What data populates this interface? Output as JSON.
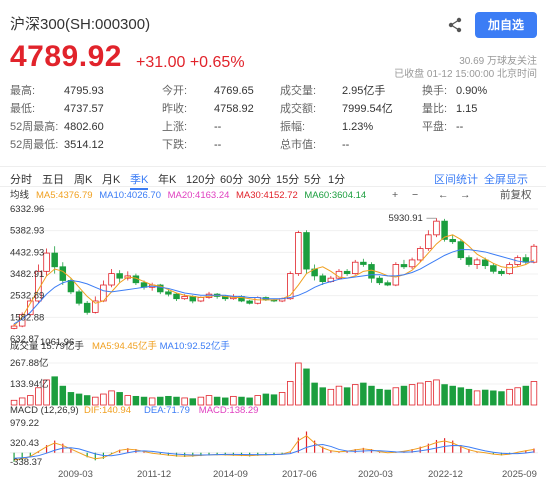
{
  "header": {
    "title": "沪深300(SH:000300)",
    "add_label": "加自选",
    "price": "4789.92",
    "change": "+31.00 +0.65%",
    "followers": "30.69 万球友关注",
    "status": "已收盘 01-12 15:00:00 北京时间"
  },
  "stats": [
    [
      {
        "l": "最高:",
        "v": "4795.93",
        "c": "red"
      },
      {
        "l": "今开:",
        "v": "4769.65",
        "c": "red"
      },
      {
        "l": "成交量:",
        "v": "2.95亿手",
        "c": ""
      },
      {
        "l": "换手:",
        "v": "0.90%",
        "c": ""
      }
    ],
    [
      {
        "l": "最低:",
        "v": "4737.57",
        "c": "green"
      },
      {
        "l": "昨收:",
        "v": "4758.92",
        "c": ""
      },
      {
        "l": "成交额:",
        "v": "7999.54亿",
        "c": ""
      },
      {
        "l": "量比:",
        "v": "1.15",
        "c": "red"
      }
    ],
    [
      {
        "l": "52周最高:",
        "v": "4802.60",
        "c": ""
      },
      {
        "l": "上涨:",
        "v": "--",
        "c": ""
      },
      {
        "l": "振幅:",
        "v": "1.23%",
        "c": ""
      },
      {
        "l": "平盘:",
        "v": "--",
        "c": ""
      }
    ],
    [
      {
        "l": "52周最低:",
        "v": "3514.12",
        "c": ""
      },
      {
        "l": "下跌:",
        "v": "--",
        "c": ""
      },
      {
        "l": "总市值:",
        "v": "--",
        "c": ""
      },
      {
        "l": "",
        "v": "",
        "c": ""
      }
    ]
  ],
  "tabs": [
    "分时",
    "五日",
    "周K",
    "月K",
    "季K",
    "年K",
    "120分",
    "60分",
    "30分",
    "15分",
    "5分",
    "1分"
  ],
  "active_tab": "季K",
  "right_tabs": [
    "区间统计",
    "全屏显示"
  ],
  "ma_legend": {
    "title": "均线",
    "items": [
      {
        "t": "MA5:4376.79",
        "color": "#f0a020"
      },
      {
        "t": "MA10:4026.70",
        "color": "#3c7df5"
      },
      {
        "t": "MA20:4163.24",
        "color": "#e040c0"
      },
      {
        "t": "MA30:4152.72",
        "color": "#e1232b"
      },
      {
        "t": "MA60:3604.14",
        "color": "#1b9e3e"
      }
    ],
    "toolbar": [
      "+",
      "−",
      "←",
      "→",
      "前复权"
    ]
  },
  "price_axis": [
    "6332.96",
    "5382.93",
    "4432.93",
    "3482.91",
    "2532.89",
    "1582.88",
    "632.87"
  ],
  "annotations": {
    "high": "5930.91",
    "low": "1061.96"
  },
  "vol_legend": {
    "title": "成交量 15.79亿手",
    "items": [
      {
        "t": "MA5:94.45亿手",
        "color": "#f0a020"
      },
      {
        "t": "MA10:92.52亿手",
        "color": "#3c7df5"
      }
    ]
  },
  "vol_axis": [
    "267.88亿",
    "133.94亿"
  ],
  "macd_legend": {
    "title": "MACD (12,26,9)",
    "items": [
      {
        "t": "DIF:140.94",
        "color": "#f0a020"
      },
      {
        "t": "DEA:71.79",
        "color": "#3c7df5"
      },
      {
        "t": "MACD:138.29",
        "color": "#e040c0"
      }
    ]
  },
  "macd_axis": [
    "979.22",
    "320.43",
    "-338.37"
  ],
  "x_axis": [
    "2009-03",
    "2011-12",
    "2014-09",
    "2017-06",
    "2020-03",
    "2022-12",
    "2025-09"
  ],
  "chart_data": {
    "type": "candlestick",
    "ylim": [
      632.87,
      6332.96
    ],
    "candles": [
      [
        1100,
        1200,
        1300,
        1062
      ],
      [
        1200,
        1700,
        1800,
        1150
      ],
      [
        1700,
        2300,
        2400,
        1650
      ],
      [
        2300,
        3600,
        3900,
        2200
      ],
      [
        3600,
        4400,
        4600,
        3400
      ],
      [
        4400,
        3800,
        4700,
        3500
      ],
      [
        3800,
        3200,
        4000,
        3000
      ],
      [
        3200,
        2700,
        3300,
        2600
      ],
      [
        2700,
        2200,
        2800,
        2100
      ],
      [
        2200,
        1800,
        2300,
        1700
      ],
      [
        1800,
        2300,
        2500,
        1750
      ],
      [
        2300,
        3000,
        3200,
        2250
      ],
      [
        3000,
        3500,
        3700,
        2900
      ],
      [
        3500,
        3300,
        3650,
        3100
      ],
      [
        3300,
        3400,
        3600,
        3200
      ],
      [
        3400,
        3100,
        3500,
        3000
      ],
      [
        3100,
        2900,
        3200,
        2800
      ],
      [
        2900,
        3000,
        3100,
        2750
      ],
      [
        3000,
        2700,
        3050,
        2600
      ],
      [
        2700,
        2600,
        2800,
        2500
      ],
      [
        2600,
        2400,
        2650,
        2300
      ],
      [
        2400,
        2500,
        2600,
        2350
      ],
      [
        2500,
        2300,
        2550,
        2200
      ],
      [
        2300,
        2450,
        2500,
        2250
      ],
      [
        2450,
        2600,
        2700,
        2400
      ],
      [
        2600,
        2500,
        2650,
        2400
      ],
      [
        2500,
        2400,
        2550,
        2300
      ],
      [
        2400,
        2500,
        2600,
        2350
      ],
      [
        2500,
        2300,
        2550,
        2250
      ],
      [
        2300,
        2200,
        2350,
        2150
      ],
      [
        2200,
        2450,
        2500,
        2150
      ],
      [
        2450,
        2350,
        2500,
        2300
      ],
      [
        2350,
        2300,
        2400,
        2250
      ],
      [
        2300,
        2400,
        2450,
        2250
      ],
      [
        2400,
        3500,
        3600,
        2350
      ],
      [
        3500,
        5300,
        5380,
        3400
      ],
      [
        5300,
        3700,
        5400,
        3500
      ],
      [
        3700,
        3400,
        3900,
        3200
      ],
      [
        3400,
        3150,
        3500,
        3000
      ],
      [
        3150,
        3300,
        3400,
        3100
      ],
      [
        3300,
        3600,
        3700,
        3250
      ],
      [
        3600,
        3500,
        3700,
        3400
      ],
      [
        3500,
        4000,
        4100,
        3450
      ],
      [
        4000,
        3900,
        4150,
        3800
      ],
      [
        3900,
        3300,
        4000,
        3100
      ],
      [
        3300,
        3100,
        3400,
        3000
      ],
      [
        3100,
        3000,
        3200,
        2950
      ],
      [
        3000,
        3900,
        4000,
        2950
      ],
      [
        3900,
        3800,
        4100,
        3700
      ],
      [
        3800,
        4100,
        4200,
        3700
      ],
      [
        4100,
        4600,
        4700,
        4000
      ],
      [
        4600,
        5200,
        5400,
        4500
      ],
      [
        5200,
        5800,
        5930,
        5100
      ],
      [
        5800,
        5000,
        5900,
        4900
      ],
      [
        5000,
        4900,
        5200,
        4800
      ],
      [
        4900,
        4200,
        5000,
        4100
      ],
      [
        4200,
        3900,
        4300,
        3800
      ],
      [
        3900,
        4100,
        4200,
        3700
      ],
      [
        4100,
        3850,
        4200,
        3700
      ],
      [
        3850,
        3600,
        3950,
        3500
      ],
      [
        3600,
        3500,
        3700,
        3400
      ],
      [
        3500,
        3900,
        4000,
        3450
      ],
      [
        3900,
        4200,
        4300,
        3800
      ],
      [
        4200,
        4000,
        4350,
        3900
      ],
      [
        4000,
        4700,
        4800,
        3950
      ]
    ],
    "ma_series": {
      "MA5": [
        1200,
        1600,
        2200,
        2800,
        3400,
        3700,
        3600,
        3300,
        2900,
        2500,
        2200,
        2300,
        2700,
        3100,
        3350,
        3300,
        3150,
        3000,
        2950,
        2800,
        2650,
        2550,
        2500,
        2450,
        2500,
        2550,
        2500,
        2450,
        2450,
        2400,
        2350,
        2350,
        2350,
        2400,
        2550,
        3000,
        3500,
        3700,
        3800,
        3600,
        3350,
        3300,
        3400,
        3600,
        3650,
        3550,
        3400,
        3350,
        3450,
        3650,
        4000,
        4400,
        4800,
        5100,
        5200,
        5000,
        4700,
        4350,
        4150,
        3950,
        3800,
        3750,
        3800,
        3900,
        4100
      ],
      "MA10": [
        1300,
        1500,
        1800,
        2200,
        2600,
        2900,
        3100,
        3200,
        3150,
        3050,
        2900,
        2750,
        2700,
        2750,
        2800,
        2850,
        2900,
        2950,
        2900,
        2850,
        2750,
        2650,
        2600,
        2550,
        2550,
        2550,
        2550,
        2500,
        2500,
        2450,
        2450,
        2400,
        2400,
        2400,
        2450,
        2550,
        2700,
        2900,
        3050,
        3150,
        3250,
        3300,
        3350,
        3400,
        3450,
        3450,
        3400,
        3400,
        3450,
        3550,
        3700,
        3900,
        4100,
        4300,
        4450,
        4550,
        4550,
        4500,
        4450,
        4350,
        4250,
        4150,
        4050,
        4000,
        4026
      ]
    },
    "volume_values": [
      30,
      45,
      60,
      110,
      160,
      180,
      120,
      80,
      70,
      60,
      50,
      70,
      90,
      80,
      60,
      55,
      50,
      45,
      50,
      55,
      50,
      45,
      40,
      50,
      60,
      50,
      45,
      55,
      50,
      45,
      60,
      70,
      65,
      80,
      150,
      268,
      230,
      140,
      110,
      100,
      120,
      110,
      130,
      140,
      120,
      100,
      95,
      110,
      120,
      130,
      140,
      150,
      160,
      130,
      120,
      110,
      100,
      90,
      95,
      90,
      85,
      100,
      110,
      120,
      150
    ],
    "macd_values": [
      -300,
      -250,
      -150,
      50,
      250,
      400,
      300,
      150,
      0,
      -150,
      -250,
      -200,
      -50,
      100,
      150,
      120,
      50,
      -20,
      -60,
      -100,
      -130,
      -140,
      -130,
      -110,
      -90,
      -80,
      -90,
      -100,
      -110,
      -120,
      -100,
      -90,
      -80,
      -60,
      40,
      500,
      700,
      400,
      200,
      80,
      40,
      60,
      120,
      160,
      120,
      40,
      0,
      20,
      60,
      120,
      200,
      300,
      420,
      480,
      400,
      250,
      120,
      40,
      0,
      -60,
      -90,
      -60,
      20,
      80,
      138
    ]
  }
}
